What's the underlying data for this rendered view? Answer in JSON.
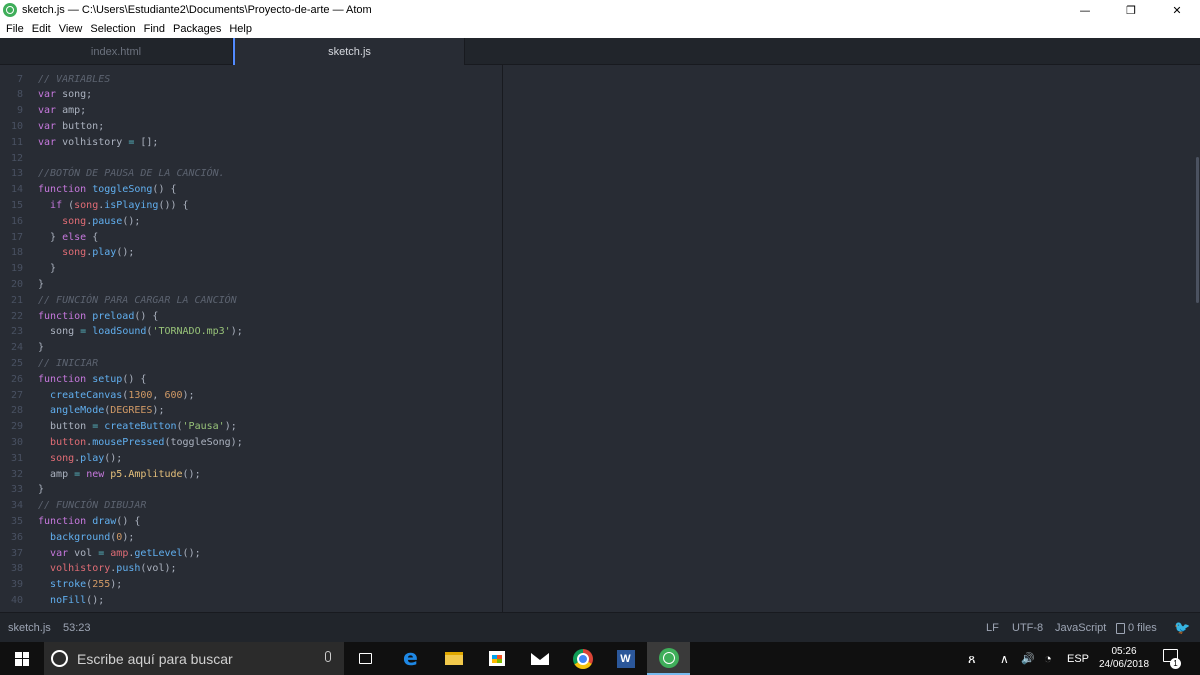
{
  "window": {
    "title": "sketch.js — C:\\Users\\Estudiante2\\Documents\\Proyecto-de-arte — Atom",
    "minimize": "—",
    "restore": "❐",
    "close": "✕"
  },
  "menu": [
    "File",
    "Edit",
    "View",
    "Selection",
    "Find",
    "Packages",
    "Help"
  ],
  "tabs": [
    {
      "label": "index.html",
      "active": false
    },
    {
      "label": "sketch.js",
      "active": true
    }
  ],
  "code_lines": [
    {
      "n": "7",
      "html": "<span class=\"c-com\">// VARIABLES</span>"
    },
    {
      "n": "8",
      "html": "<span class=\"c-kw\">var</span> song;"
    },
    {
      "n": "9",
      "html": "<span class=\"c-kw\">var</span> amp;"
    },
    {
      "n": "10",
      "html": "<span class=\"c-kw\">var</span> button;"
    },
    {
      "n": "11",
      "html": "<span class=\"c-kw\">var</span> volhistory <span class=\"c-op\">=</span> [];"
    },
    {
      "n": "12",
      "html": ""
    },
    {
      "n": "13",
      "html": "<span class=\"c-com\">//BOTÓN DE PAUSA DE LA CANCIÓN.</span>"
    },
    {
      "n": "14",
      "html": "<span class=\"c-kw\">function</span> <span class=\"c-fn\">toggleSong</span>() {"
    },
    {
      "n": "15",
      "html": "  <span class=\"c-kw\">if</span> (<span class=\"c-var\">song</span>.<span class=\"c-fn\">isPlaying</span>()) {"
    },
    {
      "n": "16",
      "html": "    <span class=\"c-var\">song</span>.<span class=\"c-fn\">pause</span>();"
    },
    {
      "n": "17",
      "html": "  } <span class=\"c-kw\">else</span> {"
    },
    {
      "n": "18",
      "html": "    <span class=\"c-var\">song</span>.<span class=\"c-fn\">play</span>();"
    },
    {
      "n": "19",
      "html": "  }"
    },
    {
      "n": "20",
      "html": "}"
    },
    {
      "n": "21",
      "html": "<span class=\"c-com\">// FUNCIÓN PARA CARGAR LA CANCIÓN</span>"
    },
    {
      "n": "22",
      "html": "<span class=\"c-kw\">function</span> <span class=\"c-fn\">preload</span>() {"
    },
    {
      "n": "23",
      "html": "  song <span class=\"c-op\">=</span> <span class=\"c-fn\">loadSound</span>(<span class=\"c-str\">'TORNADO.mp3'</span>);"
    },
    {
      "n": "24",
      "html": "}"
    },
    {
      "n": "25",
      "html": "<span class=\"c-com\">// INICIAR</span>"
    },
    {
      "n": "26",
      "html": "<span class=\"c-kw\">function</span> <span class=\"c-fn\">setup</span>() {"
    },
    {
      "n": "27",
      "html": "  <span class=\"c-fn\">createCanvas</span>(<span class=\"c-num\">1300</span>, <span class=\"c-num\">600</span>);"
    },
    {
      "n": "28",
      "html": "  <span class=\"c-fn\">angleMode</span>(<span class=\"c-num\">DEGREES</span>);"
    },
    {
      "n": "29",
      "html": "  button <span class=\"c-op\">=</span> <span class=\"c-fn\">createButton</span>(<span class=\"c-str\">'Pausa'</span>);"
    },
    {
      "n": "30",
      "html": "  <span class=\"c-var\">button</span>.<span class=\"c-fn\">mousePressed</span>(toggleSong);"
    },
    {
      "n": "31",
      "html": "  <span class=\"c-var\">song</span>.<span class=\"c-fn\">play</span>();"
    },
    {
      "n": "32",
      "html": "  amp <span class=\"c-op\">=</span> <span class=\"c-kw\">new</span> <span class=\"c-cls\">p5.Amplitude</span>();"
    },
    {
      "n": "33",
      "html": "}"
    },
    {
      "n": "34",
      "html": "<span class=\"c-com\">// FUNCIÓN DIBUJAR</span>"
    },
    {
      "n": "35",
      "html": "<span class=\"c-kw\">function</span> <span class=\"c-fn\">draw</span>() {"
    },
    {
      "n": "36",
      "html": "  <span class=\"c-fn\">background</span>(<span class=\"c-num\">0</span>);"
    },
    {
      "n": "37",
      "html": "  <span class=\"c-kw\">var</span> vol <span class=\"c-op\">=</span> <span class=\"c-var\">amp</span>.<span class=\"c-fn\">getLevel</span>();"
    },
    {
      "n": "38",
      "html": "  <span class=\"c-var\">volhistory</span>.<span class=\"c-fn\">push</span>(vol);"
    },
    {
      "n": "39",
      "html": "  <span class=\"c-fn\">stroke</span>(<span class=\"c-num\">255</span>);"
    },
    {
      "n": "40",
      "html": "  <span class=\"c-fn\">noFill</span>();"
    }
  ],
  "status": {
    "file": "sketch.js",
    "cursor": "53:23",
    "line_ending": "LF",
    "encoding": "UTF-8",
    "grammar": "JavaScript",
    "files": "0 files",
    "bird_icon": "🐦"
  },
  "taskbar": {
    "search_placeholder": "Escribe aquí para buscar",
    "word_letter": "W",
    "edge_letter": "e",
    "language": "ESP",
    "time": "05:26",
    "date": "24/06/2018",
    "notifications": "1",
    "tray_people": "ጸ",
    "tray_chevron": "∧",
    "tray_volume": "🔊",
    "tray_wifi": "◔"
  },
  "colors": {
    "editor_bg": "#282c34",
    "accent": "#528bff",
    "atom_green": "#3fae5a"
  }
}
